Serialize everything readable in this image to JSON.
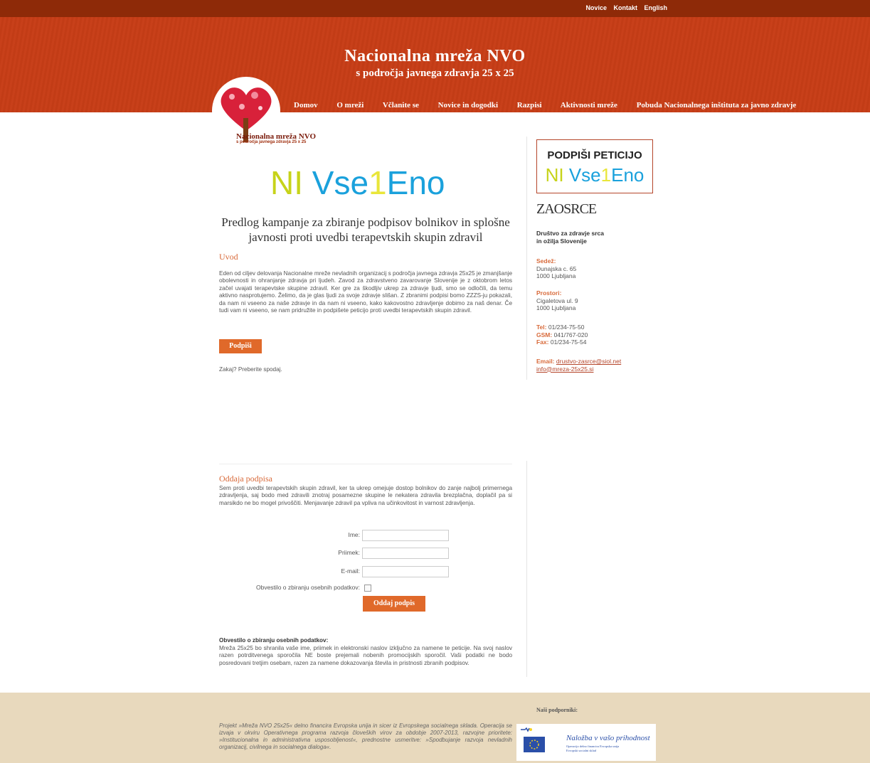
{
  "top_nav": [
    "Novice",
    "Kontakt",
    "English"
  ],
  "site": {
    "title": "Nacionalna mreža NVO",
    "subtitle": "s področja javnega zdravja 25 x 25",
    "logo_name": "Nacionalna mreža NVO",
    "logo_sub": "s področja javnega zdravja 25 x 25"
  },
  "main_nav": [
    "Domov",
    "O mreži",
    "Včlanite se",
    "Novice in dogodki",
    "Razpisi",
    "Aktivnosti mreže",
    "Pobuda Nacionalnega inštituta za javno zdravje"
  ],
  "campaign": {
    "logo_ni": "NI",
    "logo_vse": "Vse",
    "logo_one": "1",
    "logo_eno": "Eno",
    "headline": "Predlog kampanje za zbiranje podpisov bolnikov in splošne javnosti proti uvedbi terapevtskih skupin zdravil",
    "intro_heading": "Uvod",
    "intro_text": "Eden od ciljev delovanja Nacionalne mreže nevladnih organizacij s področja javnega zdravja 25x25 je zmanjšanje obolevnosti in ohranjanje zdravja pri ljudeh. Zavod za zdravstveno zavarovanje Slovenije je z oktobrom letos začel uvajati terapevtske skupine zdravil. Ker gre za škodljiv ukrep za zdravje ljudi, smo se odločili, da temu aktivno nasprotujemo. Želimo, da je glas ljudi za svoje zdravje slišan. Z zbranimi podpisi bomo ZZZS-ju pokazali, da nam ni vseeno za naše zdravje in da nam ni vseeno, kako kakovostno zdravljenje dobimo za naš denar. Če tudi vam ni vseeno, se nam pridružite in podpišete peticijo proti uvedbi terapevtskih skupin zdravil.",
    "sign_button": "Podpiši",
    "why_text": "Zakaj? Preberite spodaj."
  },
  "sidebar": {
    "petition_title": "PODPIŠI PETICIJO",
    "zasrce_logo": "ZAOSRCE",
    "org_name_1": "Društvo za zdravje srca",
    "org_name_2": "in ožilja Slovenije",
    "sedez_label": "Sedež:",
    "sedez_1": "Dunajska c. 65",
    "sedez_2": "1000 Ljubljana",
    "prostori_label": "Prostori:",
    "prostori_1": "Cigaletova ul. 9",
    "prostori_2": "1000 Ljubljana",
    "tel_label": "Tel:",
    "tel": "01/234-75-50",
    "gsm_label": "GSM:",
    "gsm": "041/767-020",
    "fax_label": "Fax:",
    "fax": "01/234-75-54",
    "email_label": "Email:",
    "email_1": "drustvo-zasrce@siol.net",
    "email_2": "info@mreza-25x25.si"
  },
  "form": {
    "heading": "Oddaja podpisa",
    "text": "Sem proti uvedbi terapevtskih skupin zdravil, ker ta ukrep omejuje dostop bolnikov do zanje najbolj primernega zdravljenja, saj bodo med zdravili znotraj posamezne skupine le nekatera zdravila brezplačna, doplačil pa si marsikdo ne bo mogel privoščiti. Menjavanje zdravil pa vpliva na učinkovitost in varnost zdravljenja.",
    "ime_label": "Ime:",
    "ime_value": "",
    "priimek_label": "Priimek:",
    "priimek_value": "",
    "email_label": "E-mail:",
    "email_value": "",
    "consent_label": "Obvestilo o zbiranju osebnih podatkov:",
    "consent_checked": false,
    "submit": "Oddaj podpis",
    "notice_heading": "Obvestilo o zbiranju osebnih podatkov:",
    "notice_text": "Mreža 25x25 bo shranila vaše ime, priimek in elektronski naslov izključno za namene te peticije. Na svoj naslov razen potrditvenega sporočila NE boste prejemali nobenih promocijskih sporočil. Vaši podatki ne bodo posredovani tretjim osebam, razen za namene dokazovanja števila in pristnosti zbranih podpisov."
  },
  "footer": {
    "text": "Projekt »Mreža NVO 25x25« delno financira Evropska unija in sicer iz Evropskega socialnega sklada. Operacija se izvaja v okviru Operativnega programa razvoja človeških virov za obdobje 2007-2013, razvojne prioritete: »Institucionalna in administrativna usposobljenost«, prednostne usmeritve: »Spodbujanje razvoja nevladnih organizacij, civilnega in socialnega dialoga«.",
    "supporters_heading": "Naši podporniki:",
    "eu_slogan": "Naložba v vašo prihodnost",
    "eu_sub": "Operacijo delno financira Evropska unija",
    "eu_sub2": "Evropski socialni sklad"
  },
  "colors": {
    "header_bg": "#c8401a",
    "topbar_bg": "#8e2a08",
    "accent": "#e0692a",
    "footer_bg": "#e8d9bd"
  }
}
